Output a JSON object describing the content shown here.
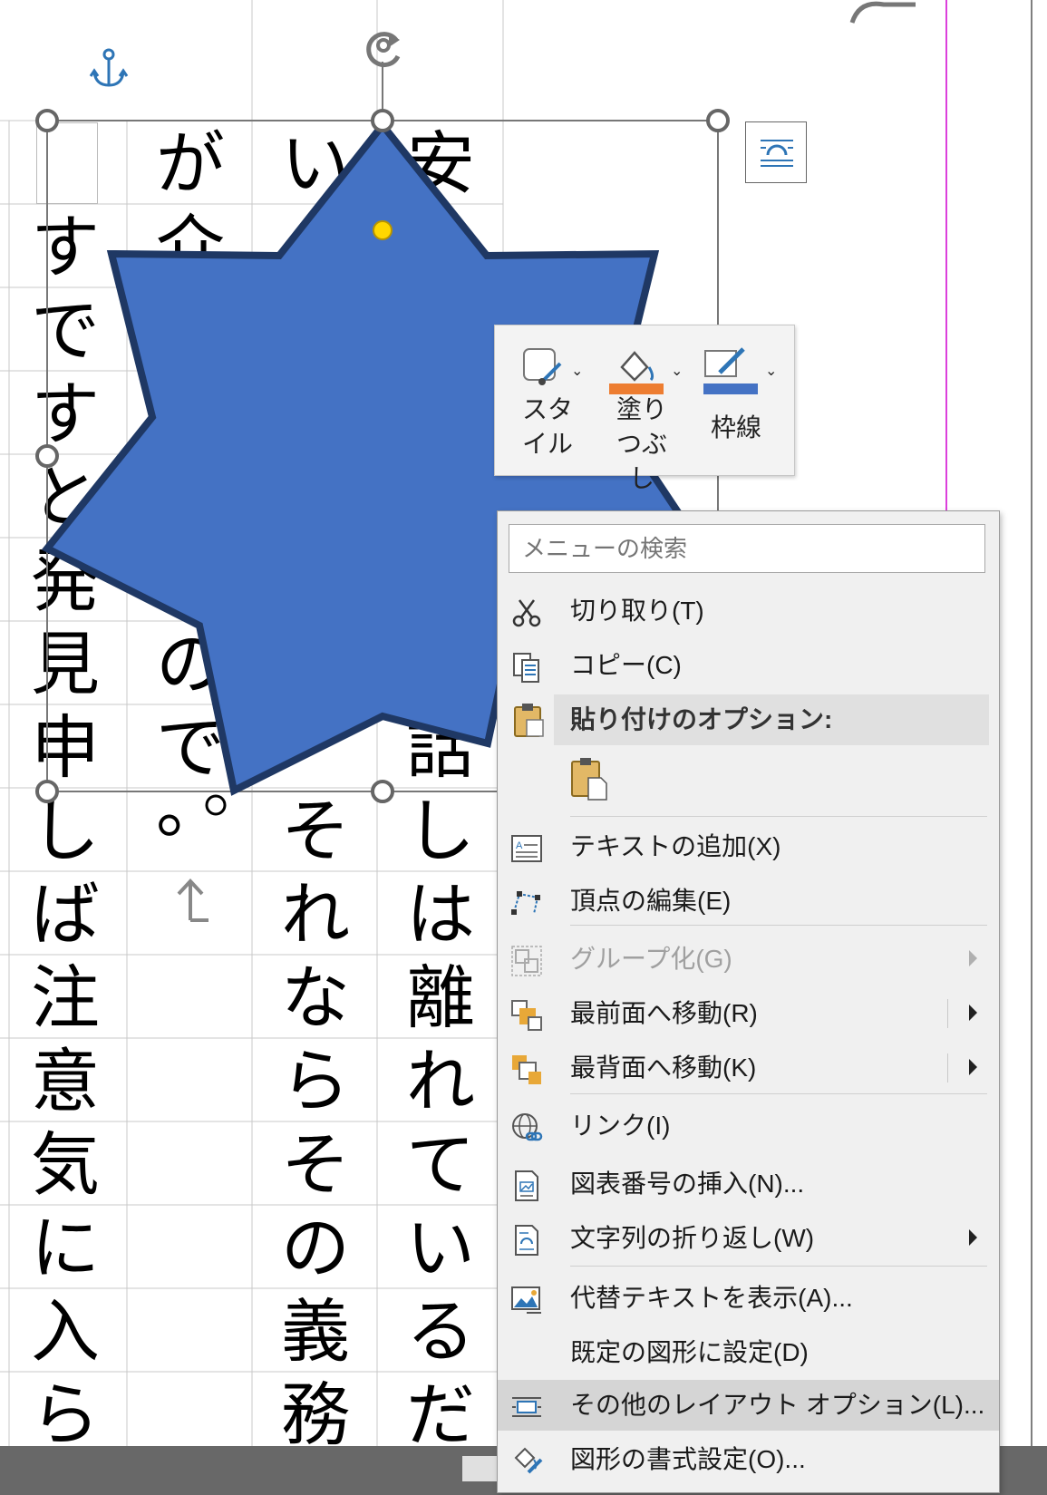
{
  "document": {
    "columns": [
      [
        "",
        "す",
        "で",
        "す",
        "と",
        "発",
        "見",
        "申",
        "し",
        "ば",
        "注",
        "意",
        "気",
        "に",
        "入",
        "ら"
      ],
      [
        "が",
        "介",
        "",
        "",
        "",
        "",
        "の",
        "で",
        "。",
        "",
        "",
        "",
        "",
        "",
        "",
        ""
      ],
      [
        "い",
        "",
        "",
        "",
        "",
        "",
        "",
        "",
        "そ",
        "れ",
        "な",
        "ら",
        "そ",
        "の",
        "義",
        "務"
      ],
      [
        "安",
        "",
        "",
        "",
        "",
        "",
        "",
        "話",
        "し",
        "は",
        "離",
        "れ",
        "て",
        "い",
        "る",
        "だ"
      ]
    ]
  },
  "mini_toolbar": {
    "style_label": "スタイル",
    "fill_label": "塗りつぶし",
    "outline_label": "枠線",
    "fill_color": "#ed7d31",
    "outline_color": "#4472c4"
  },
  "shape": {
    "fill_color": "#4472c4",
    "outline_color": "#1f3864",
    "icon": "six-point-star"
  },
  "context_menu": {
    "search_placeholder": "メニューの検索",
    "cut": "切り取り(T)",
    "copy": "コピー(C)",
    "paste_header": "貼り付けのオプション:",
    "add_text": "テキストの追加(X)",
    "edit_points": "頂点の編集(E)",
    "group": "グループ化(G)",
    "bring_front": "最前面へ移動(R)",
    "send_back": "最背面へ移動(K)",
    "link": "リンク(I)",
    "insert_caption": "図表番号の挿入(N)...",
    "wrap_text": "文字列の折り返し(W)",
    "alt_text": "代替テキストを表示(A)...",
    "set_default": "既定の図形に設定(D)",
    "more_layout": "その他のレイアウト オプション(L)...",
    "format_shape": "図形の書式設定(O)..."
  }
}
